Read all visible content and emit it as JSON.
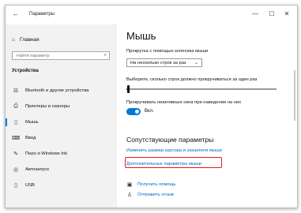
{
  "window": {
    "title": "Параметры",
    "back_icon": "←",
    "controls": {
      "minimize": "—",
      "maximize": "☐",
      "close": "✕"
    }
  },
  "sidebar": {
    "home_label": "Главная",
    "home_icon": "⌂",
    "search_placeholder": "Найти параметр",
    "search_icon": "⌕",
    "section_title": "Устройства",
    "items": [
      {
        "label": "Bluetooth и другие устройства",
        "icon": "⊟",
        "active": false
      },
      {
        "label": "Принтеры и сканеры",
        "icon": "⎙",
        "active": false
      },
      {
        "label": "Мышь",
        "icon": "▯",
        "active": true
      },
      {
        "label": "Ввод",
        "icon": "⌨",
        "active": false
      },
      {
        "label": "Перо и Windows Ink",
        "icon": "✎",
        "active": false
      },
      {
        "label": "Автозапуск",
        "icon": "◎",
        "active": false
      },
      {
        "label": "USB",
        "icon": "▯",
        "active": false
      }
    ]
  },
  "main": {
    "title": "Мышь",
    "scroll_wheel_label": "Прокрутка с помощью колесика мыши",
    "scroll_wheel_value": "На несколько строк за раз",
    "lines_label": "Выберите, сколько строк должно прокручиваться за один раз",
    "lines_slider_fraction": 0.01,
    "inactive_scroll_label": "Прокручивать неактивные окна при наведении на них",
    "toggle_state_text": "Вкл.",
    "toggle_on": true,
    "related_title": "Сопутствующие параметры",
    "link_cursor": "Изменить размер курсора и указателя мыши",
    "link_additional": "Дополнительные параметры мыши",
    "help_label": "Получить помощь",
    "feedback_label": "Отправить отзыв",
    "colors": {
      "accent": "#0078d7",
      "highlight_box": "#e02020",
      "link": "#0067c0"
    }
  }
}
